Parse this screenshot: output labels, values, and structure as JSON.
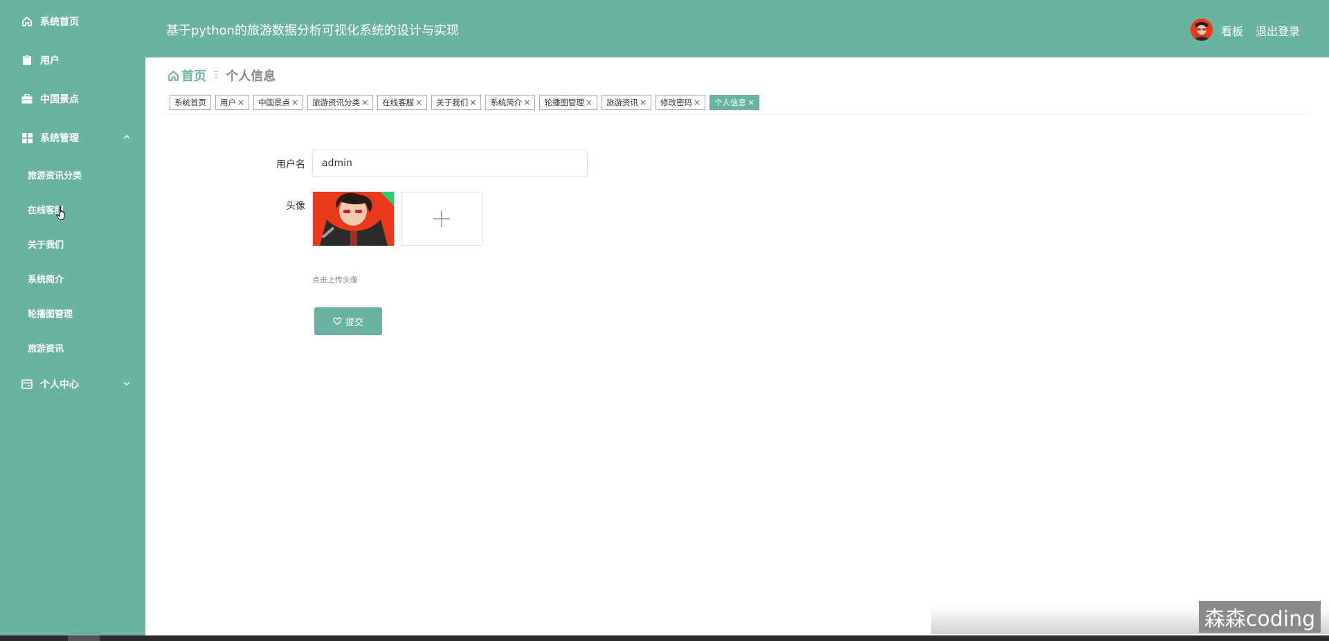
{
  "header": {
    "title": "基于python的旅游数据分析可视化系统的设计与实现",
    "kanban_label": "看板",
    "logout_label": "退出登录"
  },
  "sidebar": {
    "items": [
      {
        "label": "系统首页",
        "icon": "home-icon"
      },
      {
        "label": "用户",
        "icon": "clipboard-icon"
      },
      {
        "label": "中国景点",
        "icon": "briefcase-icon"
      },
      {
        "label": "系统管理",
        "icon": "grid-icon",
        "expanded": true,
        "children": [
          "旅游资讯分类",
          "在线客服",
          "关于我们",
          "系统简介",
          "轮播图管理",
          "旅游资讯"
        ]
      },
      {
        "label": "个人中心",
        "icon": "card-icon",
        "expanded": false
      }
    ]
  },
  "breadcrumb": {
    "home": "首页",
    "separator": "Ξ",
    "current": "个人信息"
  },
  "tags": [
    {
      "label": "系统首页",
      "closable": false,
      "active": false
    },
    {
      "label": "用户",
      "closable": true,
      "active": false
    },
    {
      "label": "中国景点",
      "closable": true,
      "active": false
    },
    {
      "label": "旅游资讯分类",
      "closable": true,
      "active": false
    },
    {
      "label": "在线客服",
      "closable": true,
      "active": false
    },
    {
      "label": "关于我们",
      "closable": true,
      "active": false
    },
    {
      "label": "系统简介",
      "closable": true,
      "active": false
    },
    {
      "label": "轮播图管理",
      "closable": true,
      "active": false
    },
    {
      "label": "旅游资讯",
      "closable": true,
      "active": false
    },
    {
      "label": "修改密码",
      "closable": true,
      "active": false
    },
    {
      "label": "个人信息",
      "closable": true,
      "active": true
    }
  ],
  "tag_close": "×",
  "form": {
    "username_label": "用户名",
    "username_value": "admin",
    "avatar_label": "头像",
    "upload_hint": "点击上传头像",
    "submit_label": "提交"
  },
  "watermark": "森森coding",
  "colors": {
    "primary": "#69b3a0",
    "avatar_bg": "#e8391c"
  }
}
